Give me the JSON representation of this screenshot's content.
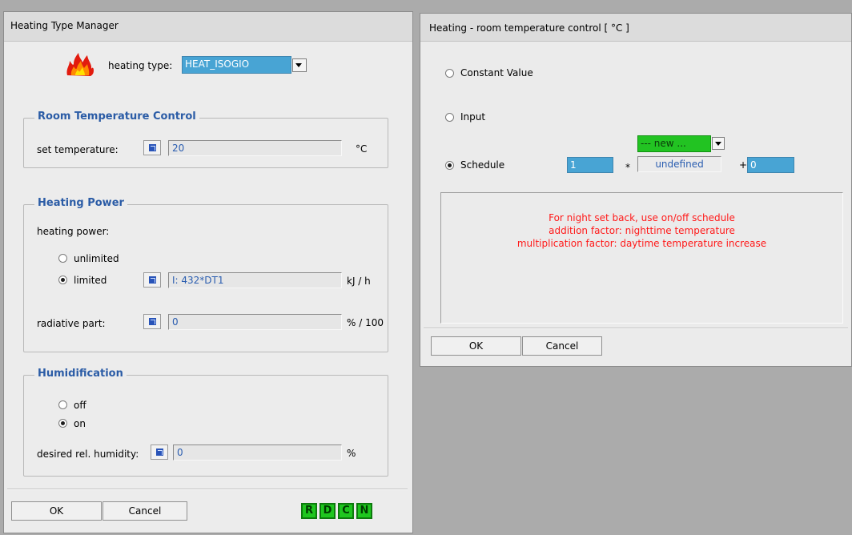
{
  "left_window": {
    "title": "Heating Type Manager",
    "heating_type_label": "heating type:",
    "heating_type_value": "HEAT_ISOGIO",
    "room_temp_group": "Room Temperature Control",
    "set_temp_label": "set temperature:",
    "set_temp_value": "20",
    "set_temp_unit": "°C",
    "heating_power_group": "Heating Power",
    "heating_power_label": "heating power:",
    "unlimited_label": "unlimited",
    "limited_label": "limited",
    "limited_value": "I: 432*DT1",
    "limited_unit": "kJ / h",
    "radiative_label": "radiative part:",
    "radiative_value": "0",
    "radiative_unit": "% / 100",
    "humid_group": "Humidification",
    "off_label": "off",
    "on_label": "on",
    "desired_label": "desired rel. humidity:",
    "desired_value": "0",
    "desired_unit": "%",
    "ok_label": "OK",
    "cancel_label": "Cancel",
    "btn_r": "R",
    "btn_d": "D",
    "btn_c": "C",
    "btn_n": "N"
  },
  "right_window": {
    "title": "Heating - room temperature control  [ °C ]",
    "constant_label": "Constant Value",
    "input_label": "Input",
    "schedule_label": "Schedule",
    "multiplier_value": "1",
    "times_sign": "*",
    "schedule_select_value": "--- new ...",
    "schedule_name": "undefined",
    "plus_sign": "+",
    "addition_value": "0",
    "note_line1": "For night set back, use on/off schedule",
    "note_line2": "addition factor: nighttime temperature",
    "note_line3": "multiplication factor: daytime temperature increase",
    "ok_label": "OK",
    "cancel_label": "Cancel"
  },
  "colors": {
    "legend_blue": "#2b5ca6",
    "field_text_blue": "#2a5db0",
    "select_blue": "#48a4d4",
    "select_green": "#22c322",
    "note_red": "#ff1a1a",
    "rdcn_green": "#1fc61f"
  }
}
